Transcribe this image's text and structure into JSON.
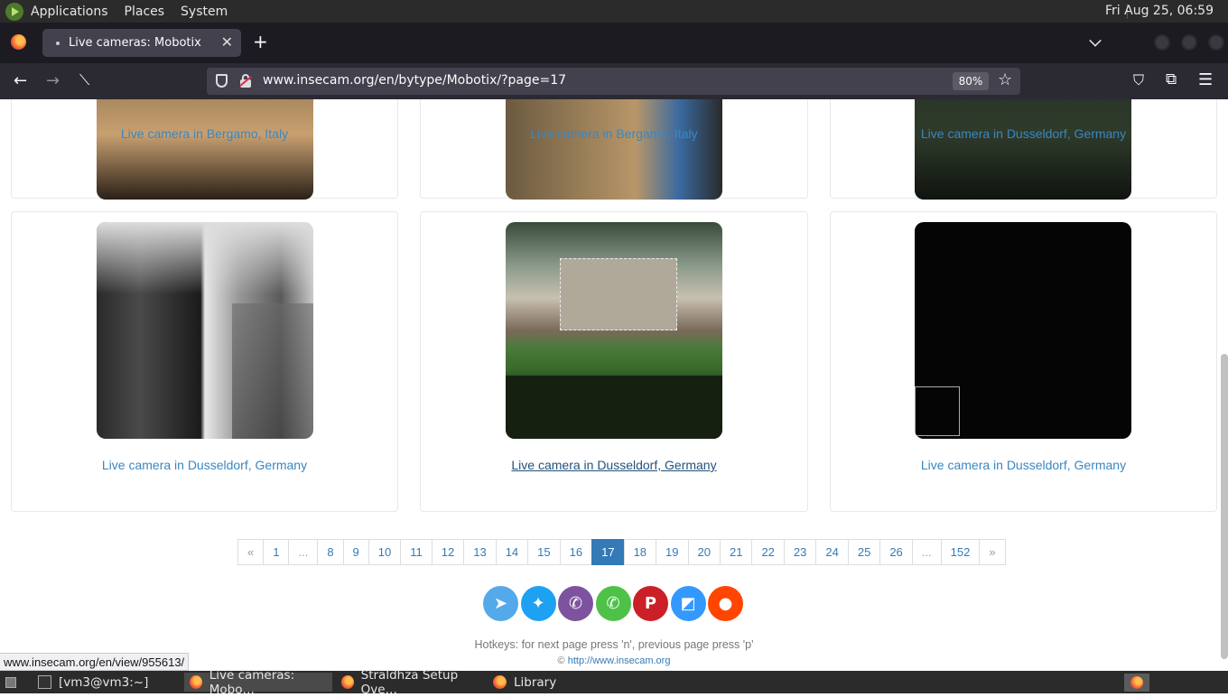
{
  "os": {
    "menu": [
      "Applications",
      "Places",
      "System"
    ],
    "clock": "Fri Aug 25, 06:59"
  },
  "browser": {
    "tab_title": "Live cameras: Mobotix",
    "url": "www.insecam.org/en/bytype/Mobotix/?page=17",
    "zoom": "80%",
    "status_url": "www.insecam.org/en/view/955613/"
  },
  "cameras_top_row": [
    {
      "caption": "Live camera in Bergamo, Italy"
    },
    {
      "caption": "Live camera in Bergamo, Italy"
    },
    {
      "caption": "Live camera in Dusseldorf, Germany"
    }
  ],
  "cameras": [
    {
      "caption": "Live camera in Dusseldorf, Germany"
    },
    {
      "caption": "Live camera in Dusseldorf, Germany"
    },
    {
      "caption": "Live camera in Dusseldorf, Germany"
    }
  ],
  "pagination": [
    "«",
    "1",
    "...",
    "8",
    "9",
    "10",
    "11",
    "12",
    "13",
    "14",
    "15",
    "16",
    "17",
    "18",
    "19",
    "20",
    "21",
    "22",
    "23",
    "24",
    "25",
    "26",
    "...",
    "152",
    "»"
  ],
  "pagination_active": "17",
  "share": [
    {
      "name": "telegram",
      "color": "#54a9eb"
    },
    {
      "name": "twitter",
      "color": "#1da1f2"
    },
    {
      "name": "viber",
      "color": "#7d539f"
    },
    {
      "name": "whatsapp",
      "color": "#4dc247"
    },
    {
      "name": "pinterest",
      "color": "#cb2027"
    },
    {
      "name": "delicious",
      "color": "#3399ff"
    },
    {
      "name": "reddit",
      "color": "#ff4500"
    }
  ],
  "footer": {
    "hotkeys": "Hotkeys: for next page press 'n', previous page press 'p'",
    "copyright_symbol": "©",
    "copyright_link": "http://www.insecam.org"
  },
  "taskbar": {
    "items": [
      "[vm3@vm3:~]",
      "Live cameras: Mobo…",
      "Straldhza Setup Ove…",
      "Library"
    ]
  }
}
